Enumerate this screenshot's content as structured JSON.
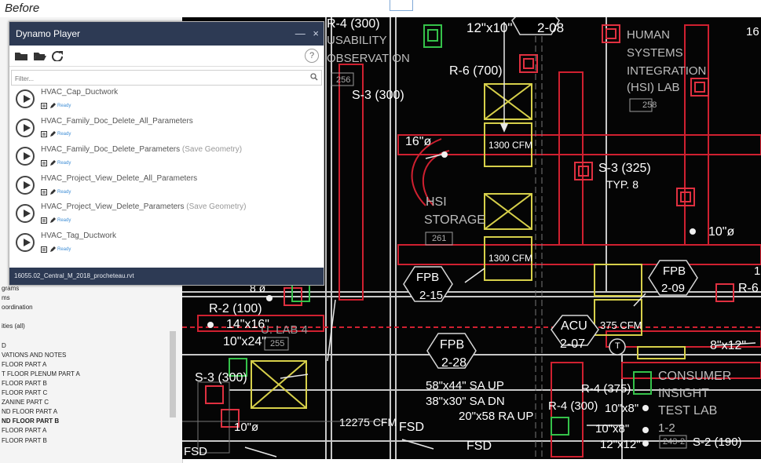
{
  "caption": "Before",
  "player": {
    "title": "Dynamo Player",
    "window_controls": [
      "—",
      "×"
    ],
    "help_label": "?",
    "filter_placeholder": "Filter...",
    "scripts": [
      {
        "name": "HVAC_Cap_Ductwork",
        "suffix": "",
        "status": "Ready"
      },
      {
        "name": "HVAC_Family_Doc_Delete_All_Parameters",
        "suffix": "",
        "status": "Ready"
      },
      {
        "name": "HVAC_Family_Doc_Delete_Parameters",
        "suffix": " (Save Geometry)",
        "status": "Ready"
      },
      {
        "name": "HVAC_Project_View_Delete_All_Parameters",
        "suffix": "",
        "status": "Ready"
      },
      {
        "name": "HVAC_Project_View_Delete_Parameters",
        "suffix": " (Save Geometry)",
        "status": "Ready"
      },
      {
        "name": "HVAC_Tag_Ductwork",
        "suffix": "",
        "status": "Ready"
      }
    ],
    "file": "16055.02_Central_M_2018_procheteau.rvt",
    "icons": [
      "folder-icon",
      "folder-open-icon",
      "refresh-icon",
      "search-icon",
      "play-icon",
      "document-icon",
      "pencil-icon"
    ]
  },
  "browser": {
    "items": [
      "grams",
      "ms",
      "oordination",
      "",
      "ities (all)",
      "",
      "D",
      "VATIONS AND NOTES",
      "FLOOR PART A",
      "T FLOOR PLENUM PART A",
      "FLOOR PART B",
      "FLOOR PART C",
      "ZANINE PART C",
      "ND FLOOR PART A",
      "ND FLOOR PART B",
      "FLOOR PART A",
      "FLOOR PART B"
    ],
    "bold_item": "ND FLOOR PART B"
  },
  "drawing": {
    "labels": [
      "R-4 (300)",
      "USABILITY",
      "OBSERVATION",
      "256",
      "12\"x10\"",
      "2-08",
      "R-6 (700)",
      "HUMAN",
      "SYSTEMS",
      "INTEGRATION",
      "(HSI) LAB",
      "258",
      "16",
      "S-3 (300)",
      "16\"ø",
      "1300 CFM",
      "S-3 (325)",
      "TYP. 8",
      "HSI",
      "STORAGE",
      "261",
      "10\"ø",
      "1300 CFM",
      "FPB",
      "2-15",
      "FPB",
      "2-09",
      "R-6",
      "1",
      "8 ø",
      "R-2 (100)",
      "14\"x16\"",
      "10\"x24\"",
      "U. LAB 4",
      "255",
      "ACU",
      "2-07",
      "375 CFM",
      "T",
      "8\"x12\"",
      "FPB",
      "2-28",
      "S-3 (300)",
      "CONSUMER",
      "INSIGHT",
      "TEST LAB",
      "1-2",
      "243-2",
      "58\"x44\" SA UP",
      "38\"x30\" SA DN",
      "20\"x58 RA UP",
      "R-4 (375)",
      "R-4 (300)",
      "10\"x8\"",
      "10\"x8\"",
      "12\"x12\"",
      "S-2 (190)",
      "12275 CFM",
      "FSD",
      "10\"ø",
      "FSD",
      "FSD"
    ]
  }
}
